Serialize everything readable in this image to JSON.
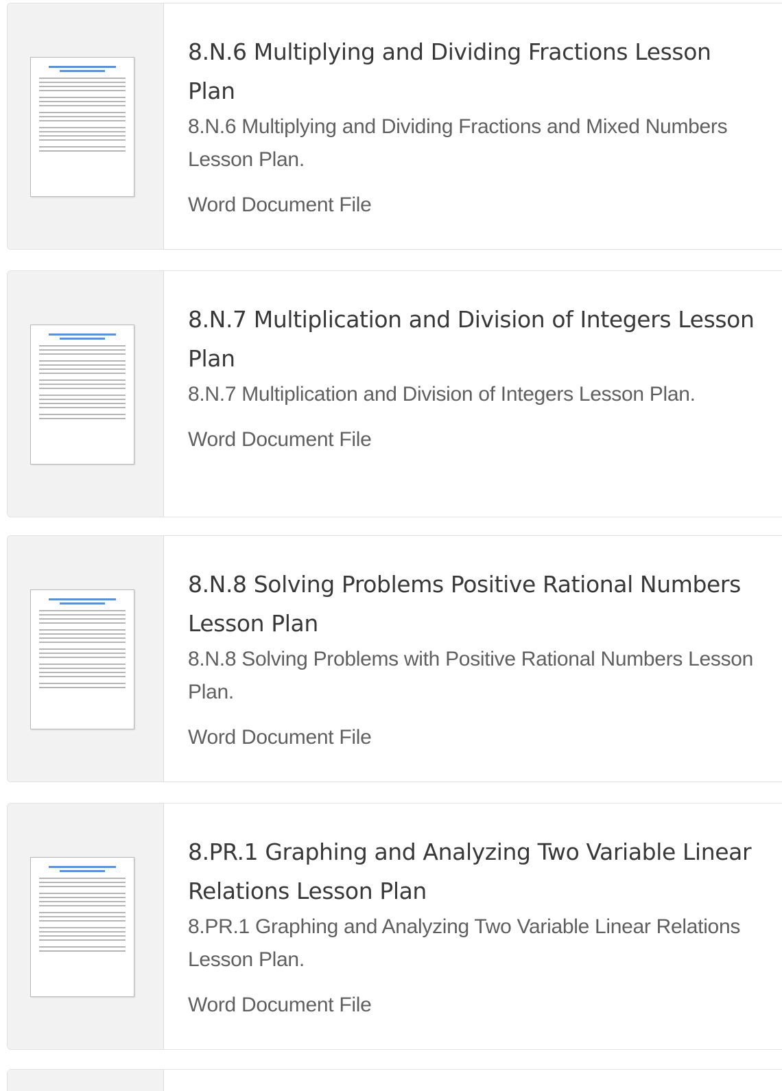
{
  "items": [
    {
      "title": "8.N.6 Multiplying and Dividing Fractions Lesson Plan",
      "description": "8.N.6 Multiplying and Dividing Fractions and Mixed Numbers Lesson Plan.",
      "file_type": "Word Document File",
      "thumbnail_icon": "document-thumbnail-icon"
    },
    {
      "title": "8.N.7 Multiplication and Division of Integers Lesson Plan",
      "description": "8.N.7 Multiplication and Division of Integers Lesson Plan.",
      "file_type": "Word Document File",
      "thumbnail_icon": "document-thumbnail-icon"
    },
    {
      "title": "8.N.8 Solving Problems Positive Rational Numbers Lesson Plan",
      "description": "8.N.8 Solving Problems with Positive Rational Numbers Lesson Plan.",
      "file_type": "Word Document File",
      "thumbnail_icon": "document-thumbnail-icon"
    },
    {
      "title": "8.PR.1 Graphing and Analyzing Two Variable Linear Relations Lesson Plan",
      "description": "8.PR.1 Graphing and Analyzing Two Variable Linear Relations Lesson Plan.",
      "file_type": "Word Document File",
      "thumbnail_icon": "document-thumbnail-icon"
    }
  ],
  "colors": {
    "thumbnail_background": "#f2f2f2",
    "title_text": "#383838",
    "body_text": "#5f5f5f",
    "thumbnail_heading_accent": "#5b8fd6"
  }
}
